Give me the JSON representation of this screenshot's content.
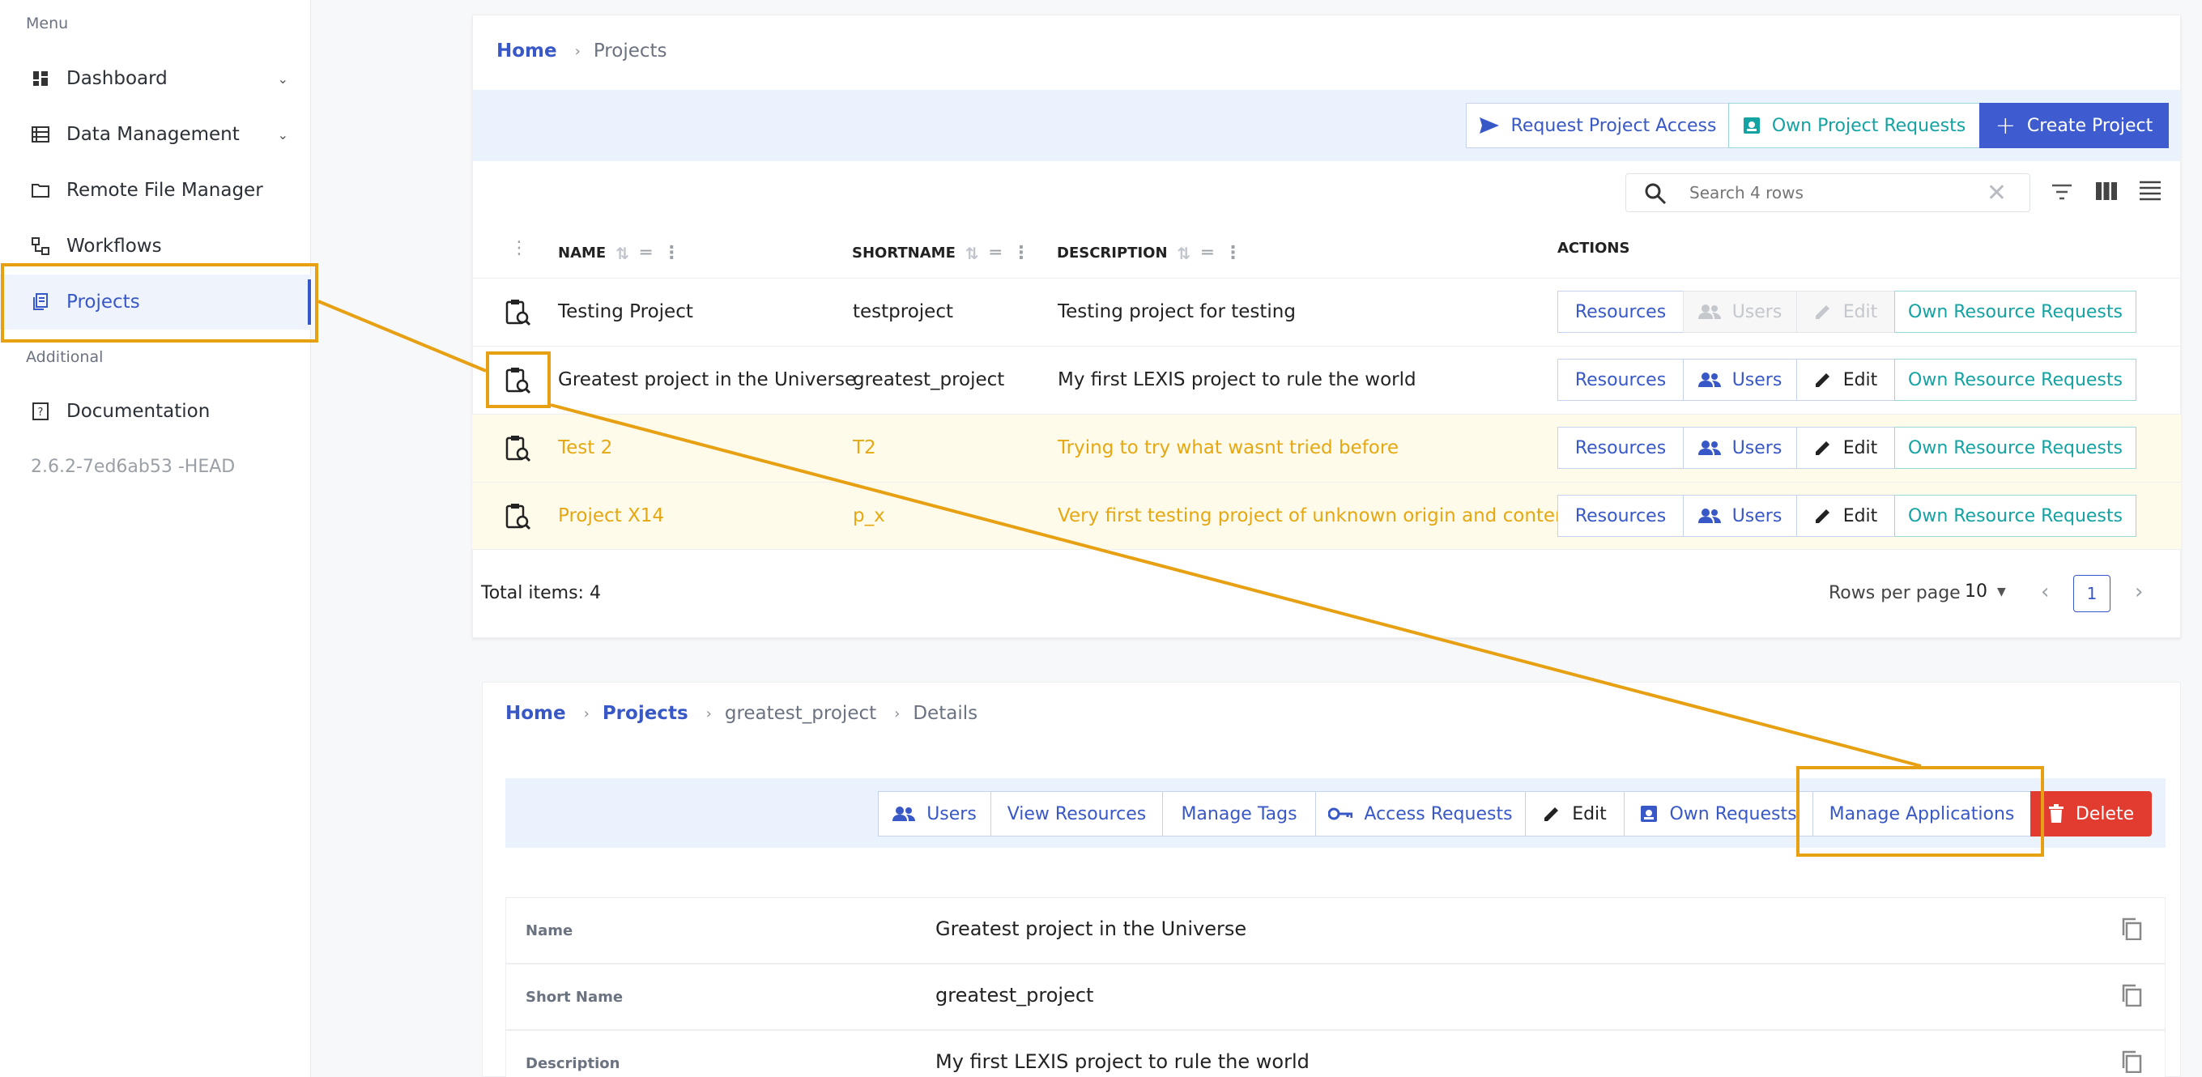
{
  "sidebar": {
    "menu_label": "Menu",
    "additional_label": "Additional",
    "items": [
      {
        "label": "Dashboard",
        "icon": "dashboard-icon"
      },
      {
        "label": "Data Management",
        "icon": "list-icon"
      },
      {
        "label": "Remote File Manager",
        "icon": "folder-icon"
      },
      {
        "label": "Workflows",
        "icon": "workflow-icon"
      },
      {
        "label": "Projects",
        "icon": "projects-icon"
      },
      {
        "label": "Documentation",
        "icon": "book-icon"
      }
    ],
    "version": "2.6.2-7ed6ab53 -HEAD"
  },
  "projects_page": {
    "breadcrumb": {
      "home": "Home",
      "current": "Projects"
    },
    "actions": {
      "request_access": "Request Project Access",
      "own_requests": "Own Project Requests",
      "create": "Create Project"
    },
    "search_placeholder": "Search 4 rows",
    "columns": {
      "name": "NAME",
      "shortname": "SHORTNAME",
      "description": "DESCRIPTION",
      "actions": "ACTIONS"
    },
    "row_actions": {
      "resources": "Resources",
      "users": "Users",
      "edit": "Edit",
      "own": "Own Resource Requests"
    },
    "rows": [
      {
        "name": "Testing Project",
        "shortname": "testproject",
        "description": "Testing project for testing"
      },
      {
        "name": "Greatest project in the Universe",
        "shortname": "greatest_project",
        "description": "My first LEXIS project to rule the world"
      },
      {
        "name": "Test 2",
        "shortname": "T2",
        "description": "Trying to try what wasnt tried before"
      },
      {
        "name": "Project X14",
        "shortname": "p_x",
        "description": "Very first testing project of unknown origin and content"
      }
    ],
    "total_items": "Total items: 4",
    "rows_per_page_label": "Rows per page",
    "rows_per_page_value": "10",
    "page": "1"
  },
  "details_page": {
    "breadcrumb": {
      "home": "Home",
      "projects": "Projects",
      "project": "greatest_project",
      "current": "Details"
    },
    "actions": {
      "users": "Users",
      "view_resources": "View Resources",
      "manage_tags": "Manage Tags",
      "access_requests": "Access Requests",
      "edit": "Edit",
      "own_requests": "Own Requests",
      "manage_applications": "Manage Applications",
      "delete": "Delete"
    },
    "fields": [
      {
        "label": "Name",
        "value": "Greatest project in the Universe"
      },
      {
        "label": "Short Name",
        "value": "greatest_project"
      },
      {
        "label": "Description",
        "value": "My first LEXIS project to rule the world"
      }
    ]
  },
  "colors": {
    "primary": "#3e5cd0",
    "teal": "#14a3a3",
    "highlight": "#e8a013",
    "danger": "#e23b30"
  }
}
